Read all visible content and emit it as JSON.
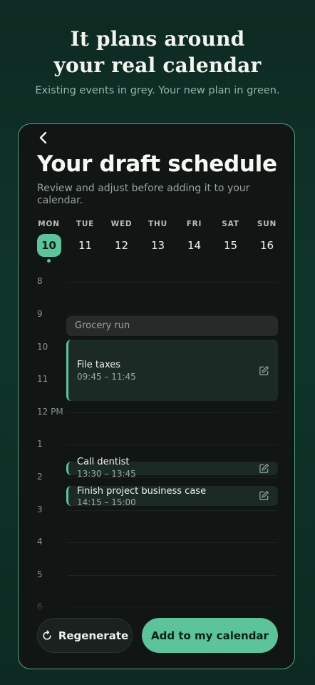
{
  "hero": {
    "title_line1": "It plans around",
    "title_line2": "your real calendar",
    "subtitle": "Existing events in grey. Your new plan in green."
  },
  "screen": {
    "title": "Your draft schedule",
    "subtitle": "Review and adjust before adding it to your calendar."
  },
  "week": {
    "selected_index": 0,
    "days": [
      {
        "dow": "MON",
        "num": "10"
      },
      {
        "dow": "TUE",
        "num": "11"
      },
      {
        "dow": "WED",
        "num": "12"
      },
      {
        "dow": "THU",
        "num": "13"
      },
      {
        "dow": "FRI",
        "num": "14"
      },
      {
        "dow": "SAT",
        "num": "15"
      },
      {
        "dow": "SUN",
        "num": "16"
      }
    ]
  },
  "timeline": {
    "hours": [
      "8",
      "9",
      "10",
      "11",
      "12 PM",
      "1",
      "2",
      "3",
      "4",
      "5",
      "6"
    ]
  },
  "events": {
    "existing": [
      {
        "title": "Grocery run"
      }
    ],
    "planned": [
      {
        "title": "File taxes",
        "time": "09:45 – 11:45"
      },
      {
        "title": "Call dentist",
        "time": "13:30 – 13:45"
      },
      {
        "title": "Finish project business case",
        "time": "14:15 – 15:00"
      }
    ]
  },
  "actions": {
    "regenerate_label": "Regenerate",
    "add_label": "Add to my calendar"
  },
  "colors": {
    "accent": "#5cc49a",
    "card_border": "#4fa483",
    "card_background": "#111614",
    "existing_event": "#262b29",
    "planned_event": "#1b2a24"
  }
}
